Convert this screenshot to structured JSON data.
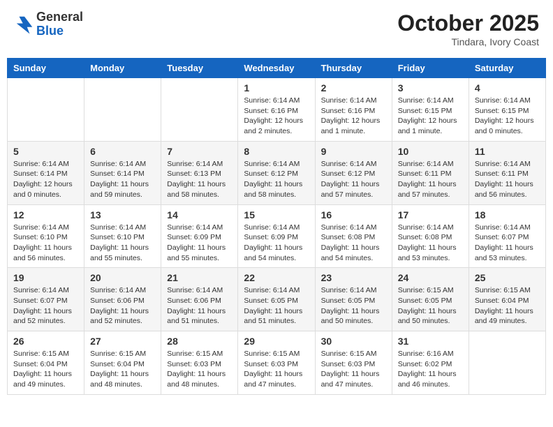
{
  "header": {
    "logo": {
      "line1": "General",
      "line2": "Blue"
    },
    "title": "October 2025",
    "subtitle": "Tindara, Ivory Coast"
  },
  "weekdays": [
    "Sunday",
    "Monday",
    "Tuesday",
    "Wednesday",
    "Thursday",
    "Friday",
    "Saturday"
  ],
  "weeks": [
    [
      {
        "day": "",
        "info": ""
      },
      {
        "day": "",
        "info": ""
      },
      {
        "day": "",
        "info": ""
      },
      {
        "day": "1",
        "info": "Sunrise: 6:14 AM\nSunset: 6:16 PM\nDaylight: 12 hours\nand 2 minutes."
      },
      {
        "day": "2",
        "info": "Sunrise: 6:14 AM\nSunset: 6:16 PM\nDaylight: 12 hours\nand 1 minute."
      },
      {
        "day": "3",
        "info": "Sunrise: 6:14 AM\nSunset: 6:15 PM\nDaylight: 12 hours\nand 1 minute."
      },
      {
        "day": "4",
        "info": "Sunrise: 6:14 AM\nSunset: 6:15 PM\nDaylight: 12 hours\nand 0 minutes."
      }
    ],
    [
      {
        "day": "5",
        "info": "Sunrise: 6:14 AM\nSunset: 6:14 PM\nDaylight: 12 hours\nand 0 minutes."
      },
      {
        "day": "6",
        "info": "Sunrise: 6:14 AM\nSunset: 6:14 PM\nDaylight: 11 hours\nand 59 minutes."
      },
      {
        "day": "7",
        "info": "Sunrise: 6:14 AM\nSunset: 6:13 PM\nDaylight: 11 hours\nand 58 minutes."
      },
      {
        "day": "8",
        "info": "Sunrise: 6:14 AM\nSunset: 6:12 PM\nDaylight: 11 hours\nand 58 minutes."
      },
      {
        "day": "9",
        "info": "Sunrise: 6:14 AM\nSunset: 6:12 PM\nDaylight: 11 hours\nand 57 minutes."
      },
      {
        "day": "10",
        "info": "Sunrise: 6:14 AM\nSunset: 6:11 PM\nDaylight: 11 hours\nand 57 minutes."
      },
      {
        "day": "11",
        "info": "Sunrise: 6:14 AM\nSunset: 6:11 PM\nDaylight: 11 hours\nand 56 minutes."
      }
    ],
    [
      {
        "day": "12",
        "info": "Sunrise: 6:14 AM\nSunset: 6:10 PM\nDaylight: 11 hours\nand 56 minutes."
      },
      {
        "day": "13",
        "info": "Sunrise: 6:14 AM\nSunset: 6:10 PM\nDaylight: 11 hours\nand 55 minutes."
      },
      {
        "day": "14",
        "info": "Sunrise: 6:14 AM\nSunset: 6:09 PM\nDaylight: 11 hours\nand 55 minutes."
      },
      {
        "day": "15",
        "info": "Sunrise: 6:14 AM\nSunset: 6:09 PM\nDaylight: 11 hours\nand 54 minutes."
      },
      {
        "day": "16",
        "info": "Sunrise: 6:14 AM\nSunset: 6:08 PM\nDaylight: 11 hours\nand 54 minutes."
      },
      {
        "day": "17",
        "info": "Sunrise: 6:14 AM\nSunset: 6:08 PM\nDaylight: 11 hours\nand 53 minutes."
      },
      {
        "day": "18",
        "info": "Sunrise: 6:14 AM\nSunset: 6:07 PM\nDaylight: 11 hours\nand 53 minutes."
      }
    ],
    [
      {
        "day": "19",
        "info": "Sunrise: 6:14 AM\nSunset: 6:07 PM\nDaylight: 11 hours\nand 52 minutes."
      },
      {
        "day": "20",
        "info": "Sunrise: 6:14 AM\nSunset: 6:06 PM\nDaylight: 11 hours\nand 52 minutes."
      },
      {
        "day": "21",
        "info": "Sunrise: 6:14 AM\nSunset: 6:06 PM\nDaylight: 11 hours\nand 51 minutes."
      },
      {
        "day": "22",
        "info": "Sunrise: 6:14 AM\nSunset: 6:05 PM\nDaylight: 11 hours\nand 51 minutes."
      },
      {
        "day": "23",
        "info": "Sunrise: 6:14 AM\nSunset: 6:05 PM\nDaylight: 11 hours\nand 50 minutes."
      },
      {
        "day": "24",
        "info": "Sunrise: 6:15 AM\nSunset: 6:05 PM\nDaylight: 11 hours\nand 50 minutes."
      },
      {
        "day": "25",
        "info": "Sunrise: 6:15 AM\nSunset: 6:04 PM\nDaylight: 11 hours\nand 49 minutes."
      }
    ],
    [
      {
        "day": "26",
        "info": "Sunrise: 6:15 AM\nSunset: 6:04 PM\nDaylight: 11 hours\nand 49 minutes."
      },
      {
        "day": "27",
        "info": "Sunrise: 6:15 AM\nSunset: 6:04 PM\nDaylight: 11 hours\nand 48 minutes."
      },
      {
        "day": "28",
        "info": "Sunrise: 6:15 AM\nSunset: 6:03 PM\nDaylight: 11 hours\nand 48 minutes."
      },
      {
        "day": "29",
        "info": "Sunrise: 6:15 AM\nSunset: 6:03 PM\nDaylight: 11 hours\nand 47 minutes."
      },
      {
        "day": "30",
        "info": "Sunrise: 6:15 AM\nSunset: 6:03 PM\nDaylight: 11 hours\nand 47 minutes."
      },
      {
        "day": "31",
        "info": "Sunrise: 6:16 AM\nSunset: 6:02 PM\nDaylight: 11 hours\nand 46 minutes."
      },
      {
        "day": "",
        "info": ""
      }
    ]
  ]
}
